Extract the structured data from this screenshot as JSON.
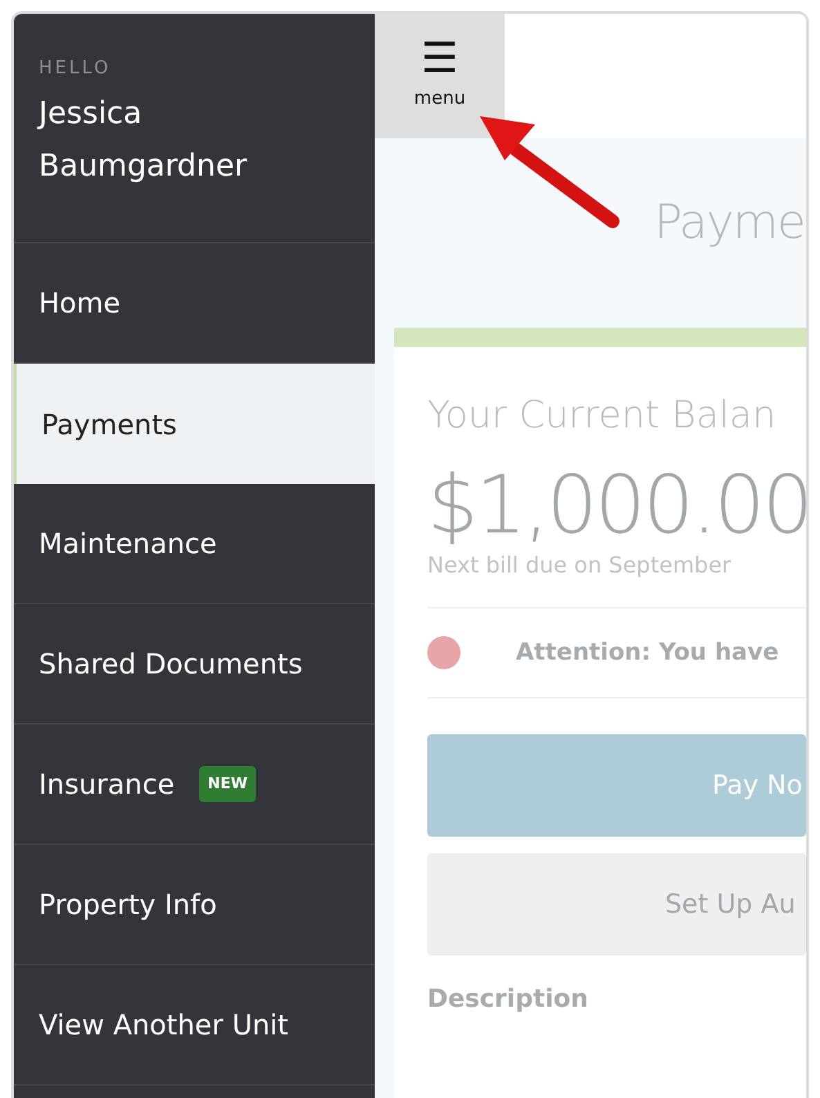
{
  "sidebar": {
    "greeting": "HELLO",
    "user_name": "Jessica Baumgardner",
    "items": [
      {
        "label": "Home",
        "selected": false
      },
      {
        "label": "Payments",
        "selected": true
      },
      {
        "label": "Maintenance",
        "selected": false
      },
      {
        "label": "Shared Documents",
        "selected": false
      },
      {
        "label": "Insurance",
        "selected": false,
        "badge": "NEW"
      },
      {
        "label": "Property Info",
        "selected": false
      },
      {
        "label": "View Another Unit",
        "selected": false
      }
    ]
  },
  "menu_button": {
    "icon": "☰",
    "label": "menu"
  },
  "annotation": {
    "kind": "arrow"
  },
  "page_title": "Payme",
  "balance_card": {
    "heading": "Your Current Balan",
    "amount": "$1,000.00",
    "due_note": "Next bill due on September",
    "alert": {
      "text": "Attention: You have",
      "color": "#e8a4a6"
    },
    "buttons": [
      {
        "label": "Pay No",
        "kind": "primary"
      },
      {
        "label": "Set Up Au",
        "kind": "secondary"
      }
    ],
    "section_label": "Description"
  }
}
